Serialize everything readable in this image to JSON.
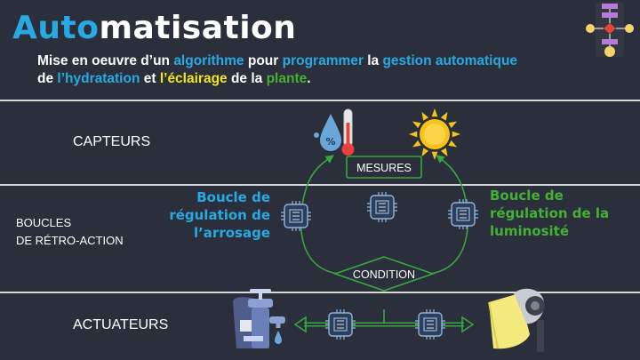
{
  "title": {
    "part1": "Auto",
    "part2": "matisation"
  },
  "subtitle": {
    "s1": "Mise en oeuvre d’un ",
    "s2": "algorithme",
    "s3": " pour ",
    "s4": "programmer",
    "s5": " la ",
    "s6": "gestion automatique",
    "s7": " de ",
    "s8": "l’hydratation",
    "s9": " et ",
    "s10": "l’éclairage",
    "s11": " de la ",
    "s12": "plante",
    "s13": "."
  },
  "rows": {
    "sensors": "CAPTEURS",
    "loops_line1": "BOUCLES",
    "loops_line2": "DE RÉTRO-ACTION",
    "actuators": "ACTUATEURS"
  },
  "diagram": {
    "measures": "MESURES",
    "condition": "CONDITION",
    "left_loop": [
      "Boucle de",
      "régulation de",
      "l’arrosage"
    ],
    "right_loop": [
      "Boucle de",
      "régulation de la",
      "luminosité"
    ]
  },
  "colors": {
    "background": "#2a2f3b",
    "accent_blue": "#29a9e1",
    "accent_yellow": "#f2e51c",
    "accent_green": "#45b035",
    "arrow_green": "#3aa640",
    "sun": "#f7c21a"
  },
  "icons": {
    "corner": "flowchart-icon",
    "humidity": "humidity-thermometer-icon",
    "sun": "sun-icon",
    "water_tap": "water-tap-icon",
    "lamp": "lamp-icon",
    "chip": "chip-icon"
  }
}
